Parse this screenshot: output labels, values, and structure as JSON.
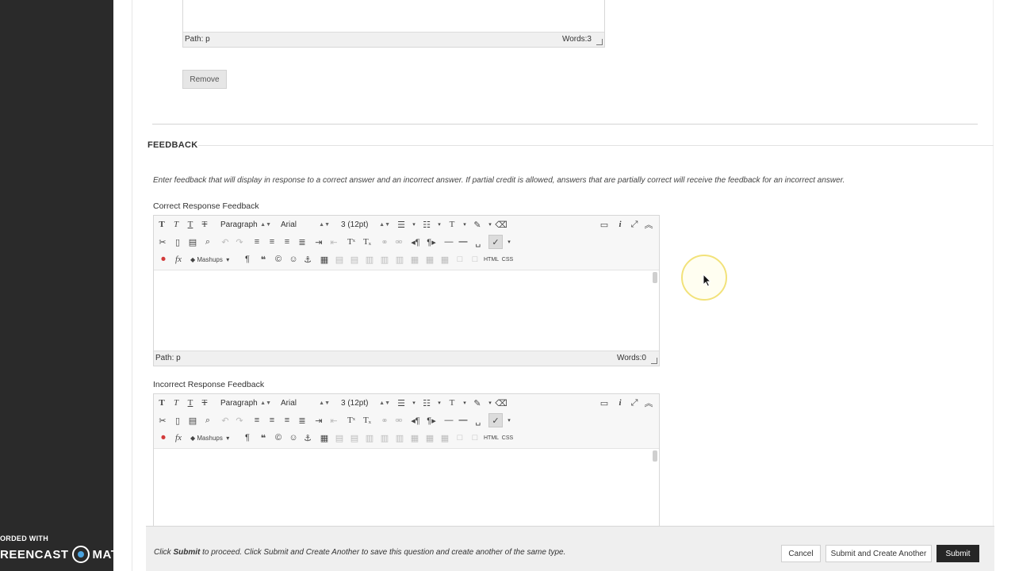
{
  "top_editor": {
    "path": "Path: p",
    "words": "Words:3"
  },
  "remove_label": "Remove",
  "feedback": {
    "title": "FEEDBACK",
    "instructions": "Enter feedback that will display in response to a correct answer and an incorrect answer. If partial credit is allowed, answers that are partially correct will receive the feedback for an incorrect answer."
  },
  "editors": {
    "correct": {
      "label": "Correct Response Feedback",
      "path": "Path: p",
      "words": "Words:0"
    },
    "incorrect": {
      "label": "Incorrect Response Feedback"
    }
  },
  "toolbar": {
    "format": "Paragraph",
    "font": "Arial",
    "size": "3 (12pt)",
    "mashups": "Mashups",
    "html": "HTML",
    "css": "CSS"
  },
  "submit_bar": {
    "note_prefix": "Click ",
    "note_bold": "Submit",
    "note_suffix": " to proceed. Click Submit and Create Another to save this question and create another of the same type.",
    "cancel": "Cancel",
    "submit_another": "Submit and Create Another",
    "submit": "Submit"
  },
  "watermark": {
    "top": "ORDED WITH",
    "left": "REENCAST",
    "right": "MATIC"
  },
  "colors": {
    "primary_button": "#262626",
    "cursor_highlight": "#f2e27a",
    "rail": "#2a2a2a"
  }
}
